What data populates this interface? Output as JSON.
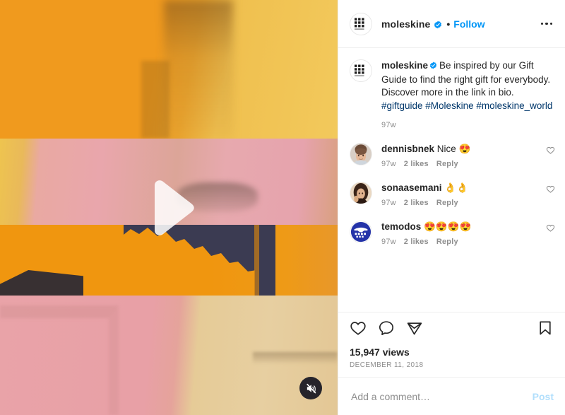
{
  "header": {
    "username": "moleskine",
    "verified_icon": "verified-badge-icon",
    "separator": "•",
    "follow_label": "Follow",
    "more_icon": "more-options-icon",
    "avatar_icon": "moleskine-logo-avatar"
  },
  "caption": {
    "username": "moleskine",
    "verified_icon": "verified-badge-icon",
    "text": "Be inspired by our Gift Guide to find the right gift for everybody. Discover more in the link in bio.",
    "hashtags": "#giftguide #Moleskine #moleskine_world",
    "time": "97w"
  },
  "comments": [
    {
      "username": "dennisbnek",
      "text": "Nice 😍",
      "time": "97w",
      "likes": "2 likes",
      "reply": "Reply",
      "like_icon": "heart-outline-icon",
      "avatar": "photo-avatar"
    },
    {
      "username": "sonaasemani",
      "text": "👌👌",
      "time": "97w",
      "likes": "2 likes",
      "reply": "Reply",
      "like_icon": "heart-outline-icon",
      "avatar": "photo-avatar"
    },
    {
      "username": "temodos",
      "text": "😍😍😍😍",
      "time": "97w",
      "likes": "2 likes",
      "reply": "Reply",
      "like_icon": "heart-outline-icon",
      "avatar": "logo-avatar"
    }
  ],
  "actions": {
    "like_icon": "heart-outline-icon",
    "comment_icon": "comment-bubble-icon",
    "share_icon": "share-paper-plane-icon",
    "save_icon": "bookmark-outline-icon",
    "views": "15,947 views",
    "date": "DECEMBER 11, 2018"
  },
  "add_comment": {
    "placeholder": "Add a comment…",
    "value": "",
    "post_label": "Post"
  },
  "media": {
    "play_icon": "play-triangle-icon",
    "mute_icon": "speaker-muted-icon"
  },
  "colors": {
    "link_blue": "#0095f6",
    "tag_blue": "#00376b",
    "text_dark": "#262626",
    "text_muted": "#8e8e8e",
    "post_disabled": "#b2dffc",
    "band_orange": "#f0960f",
    "band_yellow": "#f2c95c",
    "band_pink": "#e9a6ac",
    "band_tan": "#e6cb97",
    "navy": "#3b3b52"
  }
}
